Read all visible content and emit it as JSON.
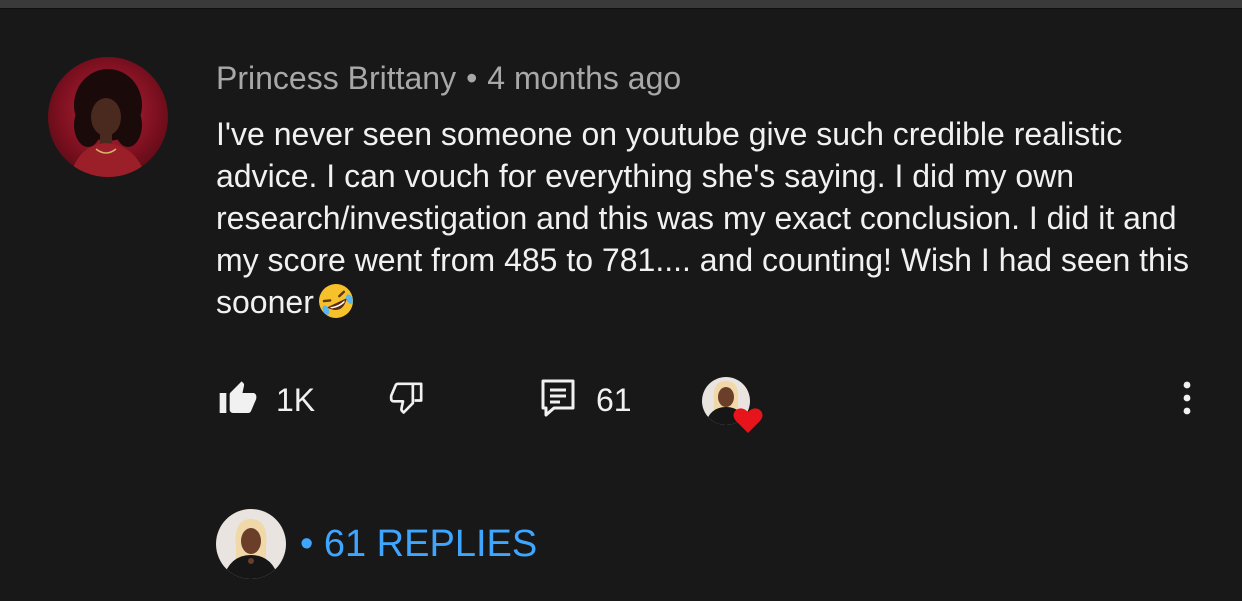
{
  "comment": {
    "author": "Princess Brittany",
    "separator": "•",
    "time": "4 months ago",
    "text": "I've never seen someone on youtube give such credible realistic advice. I can vouch for everything she's saying. I did my own research/investigation and this was my exact conclusion. I did it and my score went from 485 to 781.... and counting!  Wish I had seen this sooner",
    "emoji": "rolling-on-the-floor-laughing-emoji"
  },
  "actions": {
    "like_count": "1K",
    "reply_count": "61",
    "like_icon": "thumbs-up-icon",
    "dislike_icon": "thumbs-down-icon",
    "reply_icon": "comment-icon",
    "menu_icon": "more-vert-icon",
    "heart_icon": "heart-icon"
  },
  "replies": {
    "label": "• 61 REPLIES"
  },
  "colors": {
    "background": "#181818",
    "text": "#f1f1f1",
    "meta": "#a8a8a8",
    "link": "#3ea6ff",
    "heart": "#e8141c"
  }
}
